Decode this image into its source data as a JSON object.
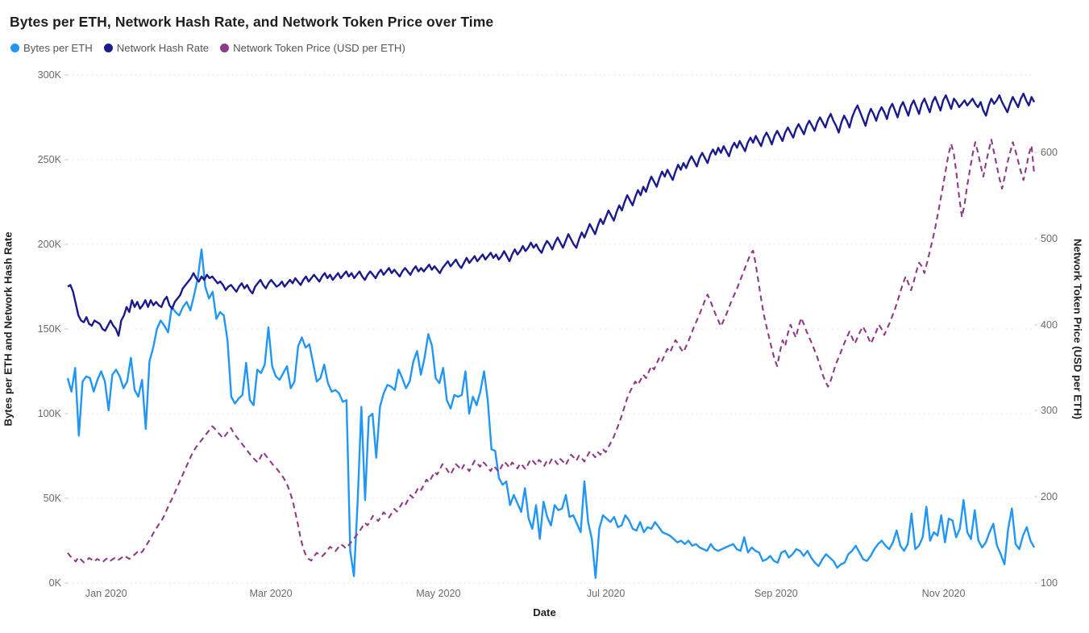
{
  "chart_data": {
    "type": "line",
    "title": "Bytes per ETH, Network Hash Rate, and Network Token Price over Time",
    "xlabel": "Date",
    "ylabel": "Bytes per ETH and Network Hash Rate",
    "ylabel_right": "Network Token Price (USD per ETH)",
    "grid": true,
    "legend_position": "top-left",
    "x_tick_labels": [
      "Jan 2020",
      "Mar 2020",
      "May 2020",
      "Jul 2020",
      "Sep 2020",
      "Nov 2020"
    ],
    "x_tick_positions_days": [
      14,
      74,
      135,
      196,
      258,
      319
    ],
    "x_range_days": [
      0,
      352
    ],
    "y_left_ticks": [
      "0K",
      "50K",
      "100K",
      "150K",
      "200K",
      "250K",
      "300K"
    ],
    "y_left_tick_values": [
      0,
      50000,
      100000,
      150000,
      200000,
      250000,
      300000
    ],
    "ylim_left": [
      0,
      300000
    ],
    "y_right_ticks": [
      "100",
      "200",
      "300",
      "400",
      "500",
      "600"
    ],
    "y_right_tick_values": [
      100,
      200,
      300,
      400,
      500,
      600
    ],
    "ylim_right": [
      100,
      690
    ],
    "colors": {
      "bytes_per_eth": "#2196f3",
      "network_hash_rate": "#1a1a8e",
      "network_token_price": "#8e3a86",
      "grid": "#d4d4d4",
      "text": "#6b6b6b",
      "title": "#1f1f1f",
      "background": "#ffffff"
    },
    "series": [
      {
        "name": "Bytes per ETH",
        "color": "#2196f3",
        "style": "solid",
        "axis": "left",
        "values": [
          121000,
          113000,
          127000,
          87000,
          119000,
          122000,
          121000,
          113000,
          120000,
          125000,
          119000,
          102000,
          123000,
          126000,
          122000,
          115000,
          119000,
          133000,
          114000,
          110000,
          120000,
          91000,
          131000,
          139000,
          150000,
          155000,
          152000,
          148000,
          163000,
          160000,
          158000,
          163000,
          166000,
          161000,
          170000,
          180000,
          197000,
          175000,
          168000,
          172000,
          156000,
          160000,
          158000,
          143000,
          110000,
          106000,
          109000,
          111000,
          130000,
          108000,
          105000,
          126000,
          124000,
          129000,
          151000,
          128000,
          122000,
          120000,
          124000,
          128000,
          115000,
          119000,
          140000,
          145000,
          139000,
          141000,
          130000,
          119000,
          121000,
          129000,
          118000,
          113000,
          114000,
          112000,
          107000,
          108000,
          19000,
          4000,
          48000,
          104000,
          49000,
          98000,
          100000,
          74000,
          104000,
          112000,
          117000,
          116000,
          114000,
          126000,
          121000,
          115000,
          119000,
          131000,
          137000,
          123000,
          133000,
          147000,
          140000,
          121000,
          118000,
          127000,
          108000,
          103000,
          111000,
          110000,
          111000,
          125000,
          100000,
          110000,
          105000,
          113000,
          125000,
          108000,
          79000,
          78000,
          62000,
          58000,
          60000,
          46000,
          52000,
          47000,
          42000,
          56000,
          38000,
          32000,
          46000,
          26000,
          48000,
          39000,
          34000,
          46000,
          43000,
          44000,
          52000,
          39000,
          40000,
          35000,
          30000,
          60000,
          36000,
          26000,
          3000,
          32000,
          40000,
          38000,
          36000,
          39000,
          33000,
          34000,
          40000,
          37000,
          32000,
          31000,
          36000,
          30000,
          33000,
          32000,
          36000,
          33000,
          30000,
          29000,
          28000,
          26000,
          24000,
          25000,
          23000,
          25000,
          22000,
          23000,
          21000,
          20000,
          19000,
          23000,
          20000,
          19000,
          20000,
          21000,
          22000,
          23000,
          20000,
          19000,
          27000,
          18000,
          21000,
          19000,
          18000,
          13000,
          14000,
          16000,
          13000,
          12000,
          18000,
          19000,
          15000,
          17000,
          20000,
          19000,
          16000,
          19000,
          15000,
          12000,
          10000,
          14000,
          17000,
          15000,
          13000,
          9000,
          11000,
          12000,
          17000,
          19000,
          22000,
          18000,
          14000,
          13000,
          16000,
          20000,
          23000,
          25000,
          22000,
          20000,
          24000,
          31000,
          22000,
          19000,
          23000,
          41000,
          20000,
          22000,
          27000,
          45000,
          25000,
          30000,
          28000,
          40000,
          24000,
          38000,
          37000,
          27000,
          32000,
          49000,
          30000,
          26000,
          43000,
          25000,
          21000,
          24000,
          30000,
          35000,
          22000,
          17000,
          11000,
          32000,
          44000,
          23000,
          20000,
          28000,
          33000,
          25000,
          21000
        ]
      },
      {
        "name": "Network Hash Rate",
        "color": "#1a1a8e",
        "style": "solid",
        "axis": "left",
        "values": [
          175000,
          176000,
          172000,
          165000,
          158000,
          155000,
          154000,
          157000,
          153000,
          152000,
          155000,
          154000,
          153000,
          150000,
          149000,
          152000,
          155000,
          152000,
          150000,
          146000,
          155000,
          158000,
          163000,
          160000,
          167000,
          163000,
          166000,
          162000,
          164000,
          167000,
          163000,
          167000,
          164000,
          166000,
          164000,
          163000,
          167000,
          169000,
          164000,
          162000,
          166000,
          168000,
          170000,
          174000,
          176000,
          178000,
          180000,
          183000,
          180000,
          178000,
          181000,
          179000,
          182000,
          180000,
          181000,
          179000,
          177000,
          178000,
          176000,
          173000,
          175000,
          176000,
          174000,
          172000,
          175000,
          177000,
          174000,
          176000,
          173000,
          171000,
          175000,
          177000,
          179000,
          176000,
          174000,
          177000,
          179000,
          177000,
          175000,
          176000,
          178000,
          175000,
          177000,
          179000,
          177000,
          180000,
          178000,
          176000,
          179000,
          181000,
          178000,
          180000,
          182000,
          180000,
          178000,
          181000,
          183000,
          180000,
          182000,
          179000,
          181000,
          183000,
          180000,
          182000,
          184000,
          181000,
          183000,
          180000,
          182000,
          184000,
          181000,
          179000,
          182000,
          184000,
          182000,
          180000,
          183000,
          185000,
          182000,
          184000,
          186000,
          183000,
          185000,
          183000,
          181000,
          184000,
          186000,
          184000,
          182000,
          185000,
          187000,
          184000,
          186000,
          184000,
          186000,
          188000,
          185000,
          187000,
          185000,
          183000,
          186000,
          188000,
          190000,
          187000,
          189000,
          191000,
          188000,
          186000,
          189000,
          192000,
          189000,
          191000,
          193000,
          190000,
          192000,
          194000,
          191000,
          193000,
          195000,
          192000,
          194000,
          191000,
          193000,
          196000,
          193000,
          190000,
          194000,
          197000,
          194000,
          196000,
          199000,
          196000,
          198000,
          201000,
          198000,
          200000,
          197000,
          195000,
          199000,
          202000,
          200000,
          197000,
          201000,
          204000,
          201000,
          198000,
          202000,
          206000,
          203000,
          200000,
          198000,
          203000,
          207000,
          204000,
          208000,
          212000,
          209000,
          206000,
          211000,
          215000,
          212000,
          216000,
          220000,
          217000,
          214000,
          219000,
          223000,
          220000,
          225000,
          229000,
          226000,
          223000,
          228000,
          232000,
          229000,
          234000,
          231000,
          236000,
          240000,
          237000,
          234000,
          239000,
          243000,
          240000,
          244000,
          241000,
          238000,
          243000,
          247000,
          244000,
          248000,
          245000,
          249000,
          252000,
          249000,
          246000,
          251000,
          254000,
          251000,
          248000,
          253000,
          256000,
          253000,
          257000,
          254000,
          258000,
          255000,
          252000,
          257000,
          260000,
          257000,
          261000,
          258000,
          255000,
          260000,
          263000,
          260000,
          264000,
          261000,
          258000,
          263000,
          266000,
          263000,
          259000,
          264000,
          267000,
          264000,
          261000,
          266000,
          269000,
          266000,
          263000,
          268000,
          271000,
          268000,
          265000,
          270000,
          273000,
          270000,
          267000,
          272000,
          275000,
          272000,
          269000,
          274000,
          277000,
          273000,
          270000,
          266000,
          272000,
          276000,
          273000,
          269000,
          275000,
          279000,
          282000,
          278000,
          274000,
          270000,
          276000,
          280000,
          277000,
          273000,
          278000,
          281000,
          278000,
          274000,
          280000,
          283000,
          279000,
          275000,
          281000,
          284000,
          280000,
          276000,
          282000,
          285000,
          281000,
          277000,
          283000,
          286000,
          282000,
          278000,
          284000,
          287000,
          283000,
          279000,
          285000,
          288000,
          284000,
          280000,
          286000,
          284000,
          281000,
          283000,
          285000,
          282000,
          284000,
          286000,
          283000,
          281000,
          284000,
          279000,
          276000,
          282000,
          286000,
          283000,
          285000,
          288000,
          284000,
          281000,
          278000,
          283000,
          287000,
          284000,
          281000,
          286000,
          289000,
          285000,
          282000,
          287000,
          284000
        ]
      },
      {
        "name": "Network Token Price (USD per ETH)",
        "color": "#8e3a86",
        "style": "dashed",
        "axis": "right",
        "values": [
          135,
          131,
          128,
          125,
          130,
          127,
          124,
          126,
          129,
          127,
          125,
          128,
          126,
          124,
          127,
          129,
          126,
          128,
          130,
          127,
          129,
          132,
          130,
          128,
          131,
          133,
          136,
          134,
          137,
          142,
          147,
          152,
          158,
          163,
          168,
          172,
          178,
          185,
          192,
          198,
          205,
          212,
          219,
          226,
          233,
          240,
          247,
          253,
          258,
          262,
          266,
          270,
          274,
          278,
          282,
          279,
          275,
          272,
          268,
          272,
          276,
          280,
          274,
          270,
          266,
          262,
          258,
          254,
          250,
          246,
          243,
          240,
          246,
          252,
          248,
          244,
          240,
          236,
          233,
          229,
          225,
          220,
          214,
          206,
          196,
          182,
          168,
          152,
          140,
          132,
          128,
          126,
          131,
          135,
          133,
          131,
          134,
          138,
          142,
          140,
          137,
          141,
          145,
          143,
          140,
          144,
          148,
          152,
          156,
          160,
          165,
          170,
          167,
          172,
          178,
          175,
          172,
          177,
          182,
          179,
          176,
          181,
          186,
          183,
          188,
          193,
          190,
          196,
          202,
          199,
          205,
          211,
          208,
          214,
          220,
          217,
          223,
          229,
          226,
          232,
          238,
          235,
          230,
          226,
          232,
          238,
          235,
          231,
          237,
          234,
          230,
          236,
          242,
          239,
          235,
          241,
          238,
          234,
          230,
          236,
          233,
          229,
          235,
          241,
          238,
          234,
          240,
          237,
          233,
          239,
          236,
          232,
          238,
          244,
          241,
          237,
          243,
          240,
          236,
          242,
          239,
          245,
          242,
          238,
          244,
          241,
          237,
          243,
          249,
          246,
          242,
          248,
          245,
          241,
          247,
          253,
          250,
          246,
          252,
          249,
          255,
          252,
          258,
          264,
          270,
          278,
          286,
          295,
          305,
          315,
          322,
          328,
          334,
          330,
          336,
          342,
          338,
          345,
          352,
          348,
          355,
          362,
          358,
          365,
          372,
          368,
          375,
          382,
          378,
          372,
          368,
          375,
          382,
          390,
          398,
          405,
          412,
          420,
          428,
          435,
          428,
          420,
          412,
          405,
          398,
          405,
          412,
          420,
          428,
          435,
          442,
          450,
          458,
          466,
          474,
          482,
          486,
          470,
          450,
          430,
          412,
          398,
          385,
          372,
          360,
          352,
          368,
          382,
          375,
          390,
          400,
          392,
          385,
          398,
          408,
          400,
          392,
          385,
          378,
          370,
          362,
          352,
          342,
          334,
          328,
          335,
          345,
          355,
          362,
          370,
          378,
          385,
          392,
          385,
          378,
          385,
          392,
          398,
          392,
          385,
          378,
          385,
          392,
          400,
          395,
          388,
          395,
          402,
          410,
          418,
          428,
          438,
          448,
          456,
          448,
          440,
          450,
          462,
          472,
          468,
          460,
          472,
          485,
          498,
          512,
          528,
          545,
          562,
          580,
          598,
          610,
          598,
          575,
          548,
          525,
          540,
          562,
          580,
          598,
          612,
          600,
          585,
          572,
          588,
          602,
          615,
          600,
          585,
          570,
          558,
          572,
          588,
          600,
          612,
          602,
          590,
          578,
          568,
          582,
          598,
          608,
          575
        ]
      }
    ]
  },
  "axis": {
    "left_title": "Bytes per ETH and Network Hash Rate",
    "right_title": "Network Token Price (USD per ETH)",
    "x_title": "Date"
  },
  "legend": {
    "items": [
      {
        "label": "Bytes per ETH",
        "color": "#2196f3",
        "marker": "circle-marker"
      },
      {
        "label": "Network Hash Rate",
        "color": "#1a1a8e",
        "marker": "circle-marker"
      },
      {
        "label": "Network Token Price (USD per ETH)",
        "color": "#8e3a86",
        "marker": "circle-marker"
      }
    ]
  }
}
